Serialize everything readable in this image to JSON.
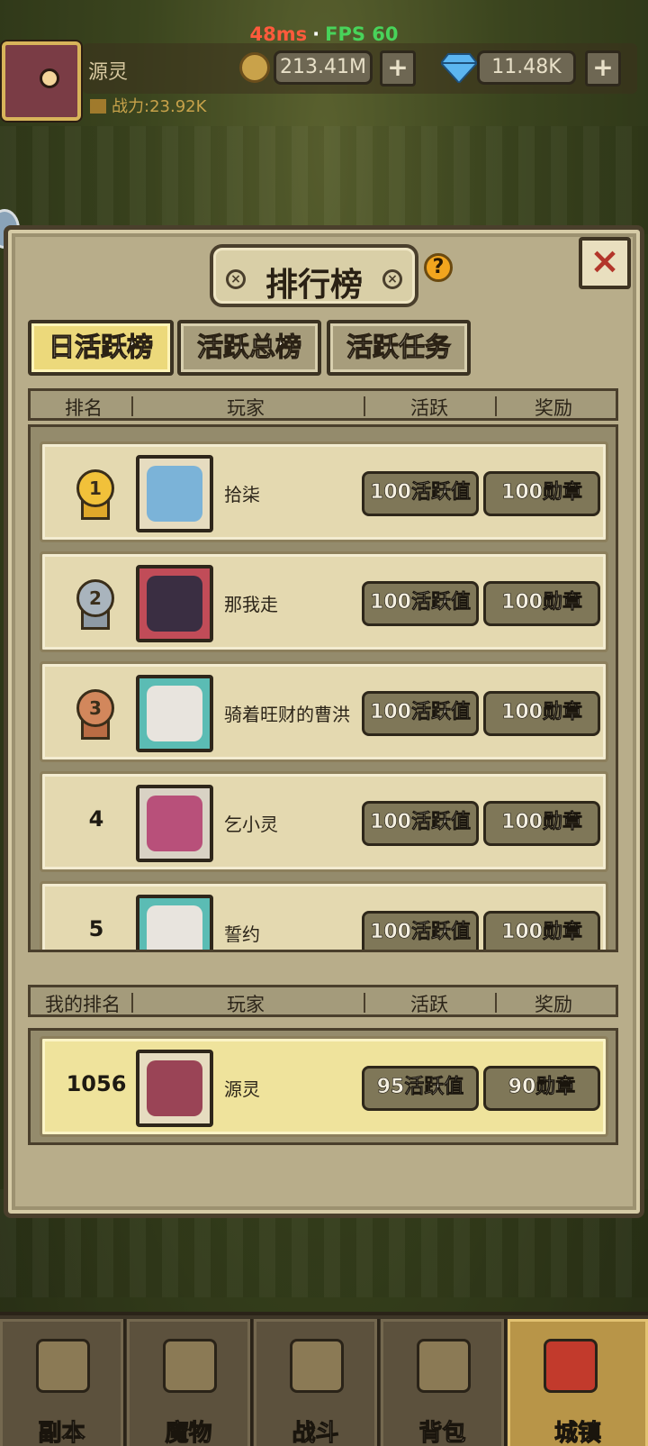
{
  "status": {
    "ping": "48ms",
    "separator": "·",
    "fps": "FPS 60"
  },
  "hud": {
    "player_name": "源灵",
    "power": "战力:23.92K",
    "gold": "213.41M",
    "gems": "11.48K",
    "plus": "+"
  },
  "modal": {
    "title": "排行榜",
    "help": "?",
    "close": "×",
    "tabs": [
      {
        "label": "日活跃榜",
        "active": true
      },
      {
        "label": "活跃总榜",
        "active": false
      },
      {
        "label": "活跃任务",
        "active": false
      }
    ],
    "headers": {
      "rank": "排名",
      "player": "玩家",
      "activity": "活跃",
      "reward": "奖励"
    },
    "rows": [
      {
        "rank": "1",
        "medal": "gold",
        "name": "拾柒",
        "activity": "100活跃值",
        "reward": "100勋章",
        "avatar_color": "#7bb3d8"
      },
      {
        "rank": "2",
        "medal": "silver",
        "name": "那我走",
        "activity": "100活跃值",
        "reward": "100勋章",
        "avatar_color": "#3a2e42"
      },
      {
        "rank": "3",
        "medal": "bronze",
        "name": "骑着旺财的曹洪",
        "activity": "100活跃值",
        "reward": "100勋章",
        "avatar_color": "#e8e4de"
      },
      {
        "rank": "4",
        "medal": "",
        "name": "乞小灵",
        "activity": "100活跃值",
        "reward": "100勋章",
        "avatar_color": "#b8507a"
      },
      {
        "rank": "5",
        "medal": "",
        "name": "誓约",
        "activity": "100活跃值",
        "reward": "100勋章",
        "avatar_color": "#e8e4de"
      }
    ],
    "my_headers": {
      "rank": "我的排名",
      "player": "玩家",
      "activity": "活跃",
      "reward": "奖励"
    },
    "me": {
      "rank": "1056",
      "name": "源灵",
      "activity": "95活跃值",
      "reward": "90勋章",
      "avatar_color": "#9a4456"
    }
  },
  "nav": [
    {
      "label": "副本",
      "icon": "map-icon",
      "active": false
    },
    {
      "label": "魔物",
      "icon": "helmet-icon",
      "active": false
    },
    {
      "label": "战斗",
      "icon": "crossed-swords-icon",
      "active": false
    },
    {
      "label": "背包",
      "icon": "backpack-icon",
      "active": false
    },
    {
      "label": "城镇",
      "icon": "town-icon",
      "active": true
    }
  ]
}
